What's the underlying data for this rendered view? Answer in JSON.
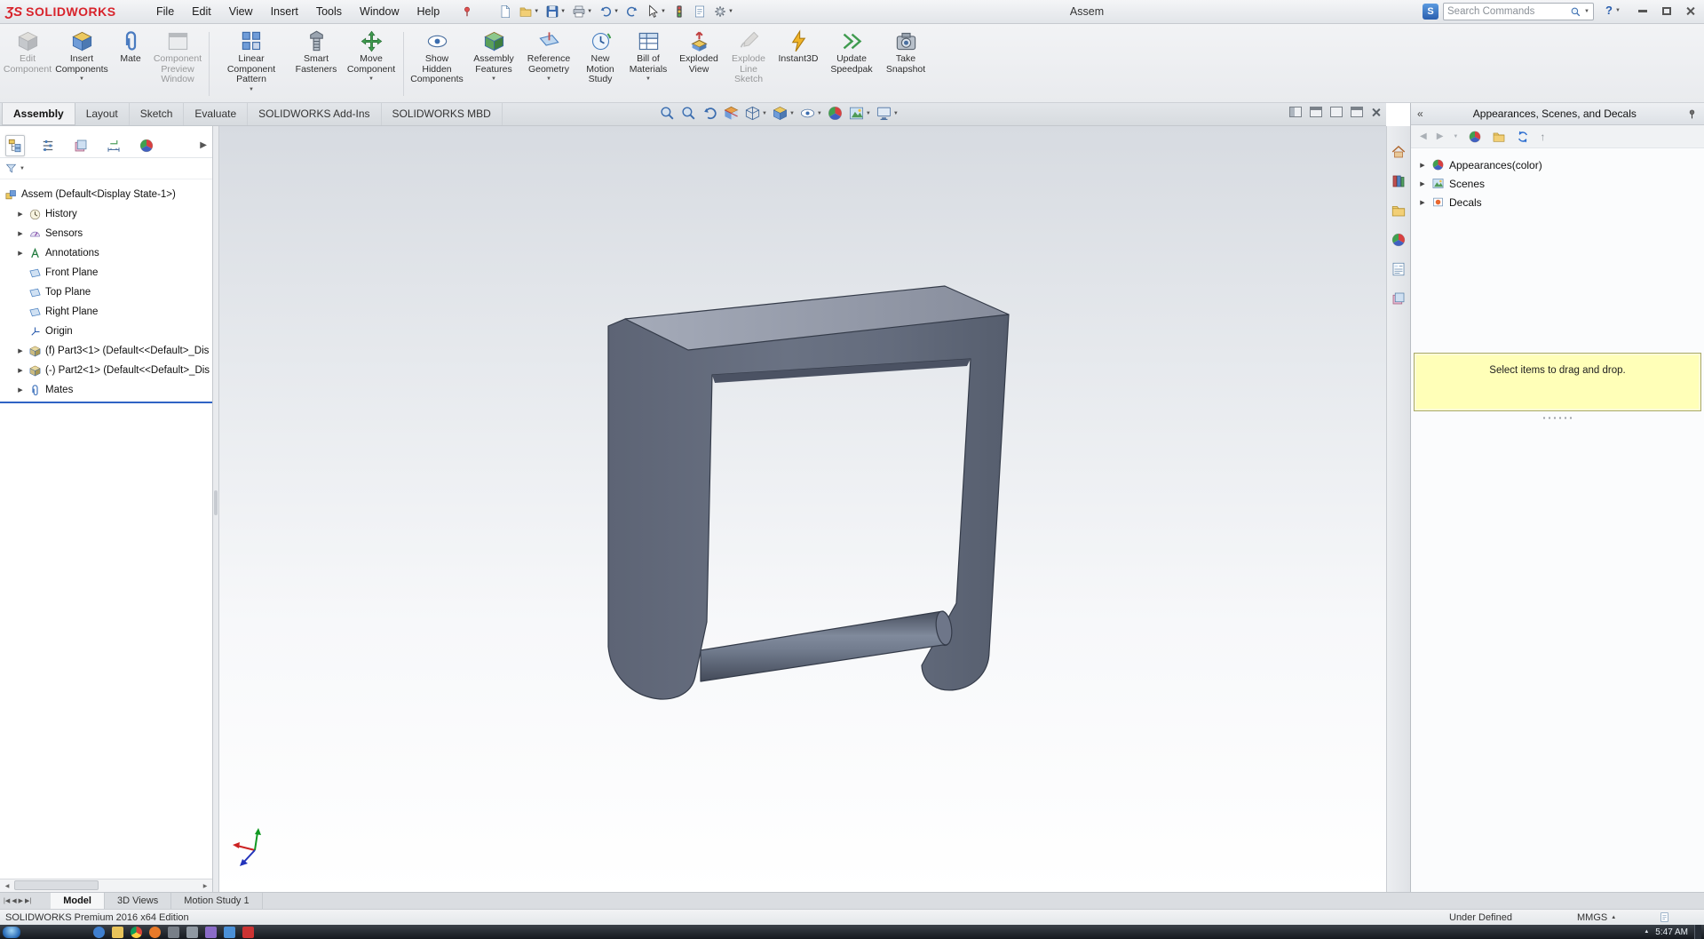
{
  "titlebar": {
    "logo_mark": "ƷS",
    "logo": "SOLIDWORKS",
    "menus": [
      "File",
      "Edit",
      "View",
      "Insert",
      "Tools",
      "Window",
      "Help"
    ],
    "document_title": "Assem",
    "search_placeholder": "Search Commands",
    "help_label": "?"
  },
  "quick_access": {
    "icons": [
      "new",
      "open",
      "save",
      "print",
      "undo",
      "redo",
      "select",
      "rebuild",
      "file-properties",
      "options"
    ]
  },
  "ribbon": {
    "buttons": [
      {
        "label": "Edit Component",
        "enabled": false,
        "arrow": false
      },
      {
        "label": "Insert Components",
        "enabled": true,
        "arrow": true
      },
      {
        "label": "Mate",
        "enabled": true,
        "arrow": false
      },
      {
        "label": "Component Preview Window",
        "enabled": false,
        "arrow": false
      },
      {
        "label": "Linear Component Pattern",
        "enabled": true,
        "arrow": true
      },
      {
        "label": "Smart Fasteners",
        "enabled": true,
        "arrow": false
      },
      {
        "label": "Move Component",
        "enabled": true,
        "arrow": true
      },
      {
        "label": "Show Hidden Components",
        "enabled": true,
        "arrow": false
      },
      {
        "label": "Assembly Features",
        "enabled": true,
        "arrow": true
      },
      {
        "label": "Reference Geometry",
        "enabled": true,
        "arrow": true
      },
      {
        "label": "New Motion Study",
        "enabled": true,
        "arrow": false
      },
      {
        "label": "Bill of Materials",
        "enabled": true,
        "arrow": true
      },
      {
        "label": "Exploded View",
        "enabled": true,
        "arrow": false
      },
      {
        "label": "Explode Line Sketch",
        "enabled": false,
        "arrow": false
      },
      {
        "label": "Instant3D",
        "enabled": true,
        "arrow": false
      },
      {
        "label": "Update Speedpak",
        "enabled": true,
        "arrow": false
      },
      {
        "label": "Take Snapshot",
        "enabled": true,
        "arrow": false
      }
    ]
  },
  "command_tabs": {
    "tabs": [
      "Assembly",
      "Layout",
      "Sketch",
      "Evaluate",
      "SOLIDWORKS Add-Ins",
      "SOLIDWORKS MBD"
    ],
    "active": "Assembly"
  },
  "view_toolbar": {
    "icons": [
      "zoom-to-fit",
      "zoom-to-area",
      "previous-view",
      "section-view",
      "view-orientation",
      "display-style",
      "hide-show-items",
      "edit-appearance",
      "apply-scene",
      "view-settings"
    ]
  },
  "feature_manager": {
    "tab_icons": [
      "featuremanager-tree",
      "propertymanager",
      "configurationmanager",
      "dimxpertmanager",
      "displaymanager"
    ],
    "items": [
      {
        "label": "Assem (Default<Display State-1>)",
        "icon": "assembly",
        "arrow": false
      },
      {
        "label": "History",
        "icon": "history",
        "arrow": true
      },
      {
        "label": "Sensors",
        "icon": "sensors",
        "arrow": true
      },
      {
        "label": "Annotations",
        "icon": "annotations",
        "arrow": true
      },
      {
        "label": "Front Plane",
        "icon": "plane",
        "arrow": false
      },
      {
        "label": "Top Plane",
        "icon": "plane",
        "arrow": false
      },
      {
        "label": "Right Plane",
        "icon": "plane",
        "arrow": false
      },
      {
        "label": "Origin",
        "icon": "origin",
        "arrow": false
      },
      {
        "label": "(f) Part3<1> (Default<<Default>_Dis",
        "icon": "part",
        "arrow": true
      },
      {
        "label": "(-) Part2<1> (Default<<Default>_Dis",
        "icon": "part",
        "arrow": true
      },
      {
        "label": "Mates",
        "icon": "mates",
        "arrow": true
      }
    ]
  },
  "task_pane": {
    "title": "Appearances, Scenes, and Decals",
    "toolbar_icons": [
      "back",
      "forward",
      "dropdown",
      "appearances",
      "open-folder",
      "refresh",
      "move-up"
    ],
    "tab_icons": [
      "solidworks-resources",
      "design-library",
      "file-explorer",
      "appearances-scenes-decals",
      "custom-properties",
      "document-recovery"
    ],
    "items": [
      {
        "label": "Appearances(color)",
        "icon": "appearances"
      },
      {
        "label": "Scenes",
        "icon": "scenes"
      },
      {
        "label": "Decals",
        "icon": "decals"
      }
    ],
    "message": "Select items to drag and drop."
  },
  "document_tabs": {
    "tabs": [
      "Model",
      "3D Views",
      "Motion Study 1"
    ],
    "active": "Model"
  },
  "status_bar": {
    "edition": "SOLIDWORKS Premium 2016 x64 Edition",
    "doc_status": "Under Defined",
    "units": "MMGS"
  },
  "taskbar": {
    "clock": "5:47 AM"
  }
}
